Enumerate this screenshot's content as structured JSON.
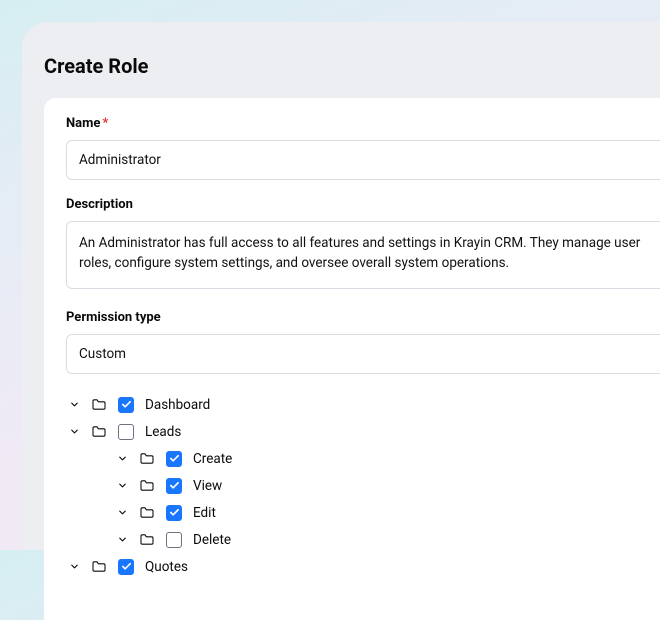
{
  "page": {
    "title": "Create Role"
  },
  "form": {
    "name": {
      "label": "Name",
      "required": "*",
      "value": "Administrator"
    },
    "description": {
      "label": "Description",
      "value": "An Administrator has full access to all features and settings in Krayin CRM. They manage user roles, configure system settings, and oversee overall system operations."
    },
    "permission": {
      "label": "Permission type",
      "value": "Custom"
    }
  },
  "tree": {
    "nodes": [
      {
        "label": "Dashboard",
        "indent": 0,
        "chev": true,
        "folder": true,
        "checked": true
      },
      {
        "label": "Leads",
        "indent": 0,
        "chev": true,
        "folder": true,
        "checked": false
      },
      {
        "label": "Create",
        "indent": 1,
        "chev": true,
        "folder": true,
        "checked": true
      },
      {
        "label": "View",
        "indent": 1,
        "chev": true,
        "folder": true,
        "checked": true
      },
      {
        "label": "Edit",
        "indent": 1,
        "chev": true,
        "folder": true,
        "checked": true
      },
      {
        "label": "Delete",
        "indent": 1,
        "chev": true,
        "folder": true,
        "checked": false
      },
      {
        "label": "Quotes",
        "indent": 0,
        "chev": true,
        "folder": true,
        "checked": true
      }
    ]
  }
}
